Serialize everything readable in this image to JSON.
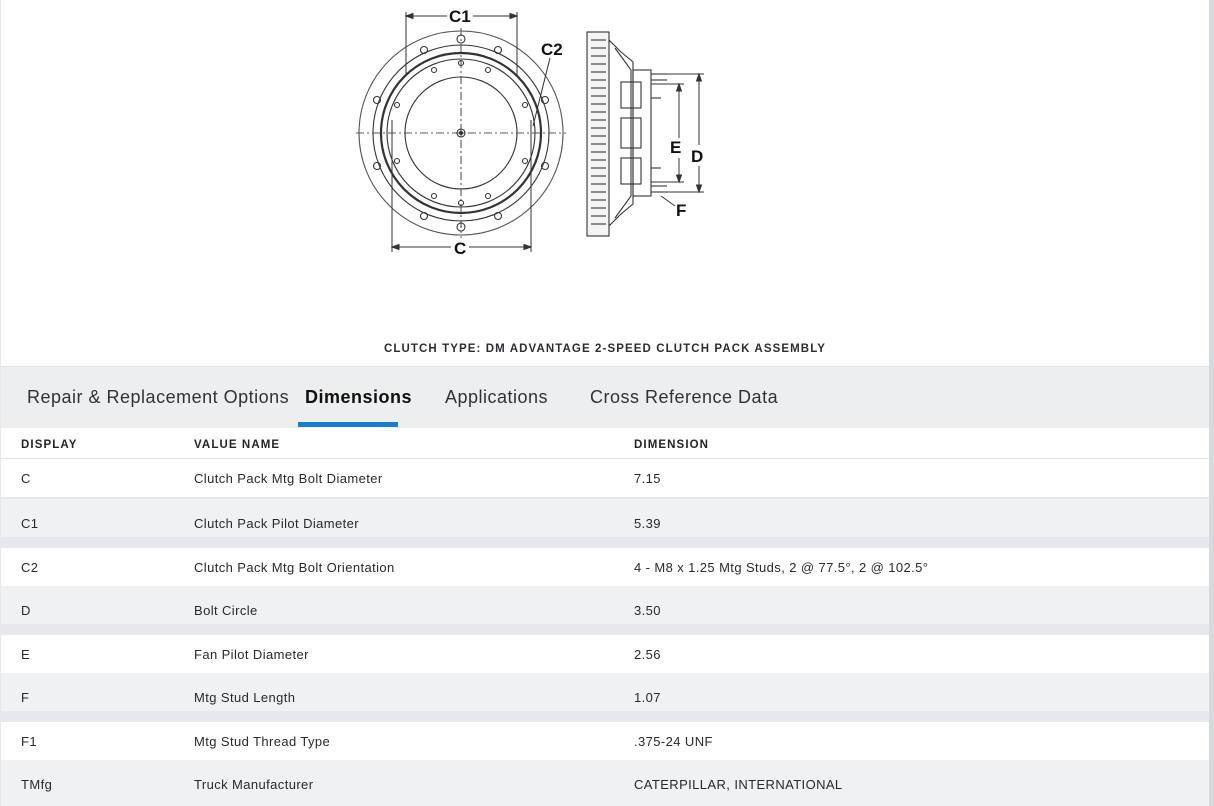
{
  "diagram": {
    "labels": {
      "c": "C",
      "c1": "C1",
      "c2": "C2",
      "d": "D",
      "e": "E",
      "f": "F"
    },
    "caption": "CLUTCH TYPE: DM ADVANTAGE 2-SPEED CLUTCH PACK ASSEMBLY"
  },
  "tabs": [
    {
      "label": "Repair & Replacement Options",
      "active": false
    },
    {
      "label": "Dimensions",
      "active": true
    },
    {
      "label": "Applications",
      "active": false
    },
    {
      "label": "Cross Reference Data",
      "active": false
    }
  ],
  "table": {
    "headers": {
      "display": "DISPLAY",
      "value_name": "VALUE NAME",
      "dimension": "DIMENSION"
    },
    "rows": [
      {
        "display": "C",
        "value_name": "Clutch Pack Mtg Bolt Diameter",
        "dimension": "7.15"
      },
      {
        "display": "C1",
        "value_name": "Clutch Pack Pilot Diameter",
        "dimension": "5.39"
      },
      {
        "display": "C2",
        "value_name": "Clutch Pack Mtg Bolt Orientation",
        "dimension": "4 - M8 x 1.25 Mtg Studs, 2 @ 77.5°, 2 @ 102.5°"
      },
      {
        "display": "D",
        "value_name": "Bolt Circle",
        "dimension": "3.50"
      },
      {
        "display": "E",
        "value_name": "Fan Pilot Diameter",
        "dimension": "2.56"
      },
      {
        "display": "F",
        "value_name": "Mtg Stud Length",
        "dimension": "1.07"
      },
      {
        "display": "F1",
        "value_name": "Mtg Stud Thread Type",
        "dimension": ".375-24 UNF"
      },
      {
        "display": "TMfg",
        "value_name": "Truck Manufacturer",
        "dimension": "CATERPILLAR, INTERNATIONAL"
      }
    ]
  },
  "colors": {
    "accent": "#1a7fc4",
    "row_alt": "#eff1f3",
    "tab_bg": "#eceef0"
  }
}
